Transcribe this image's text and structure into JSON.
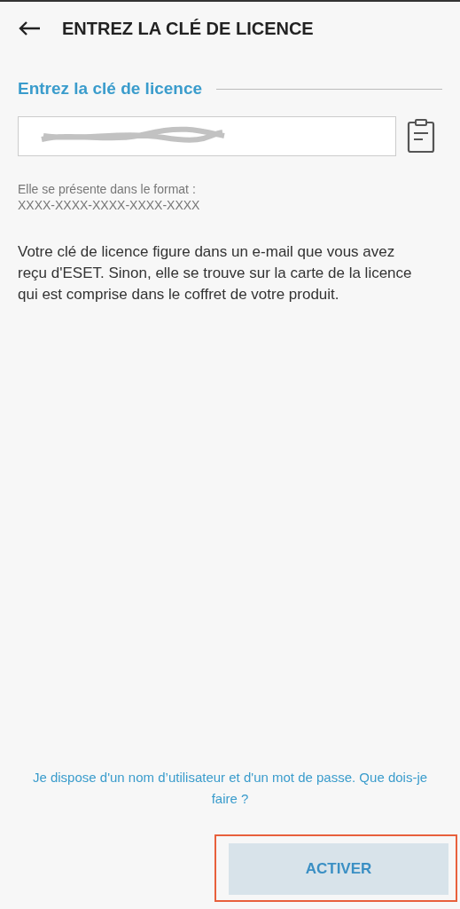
{
  "header": {
    "title": "ENTREZ LA CLÉ DE LICENCE"
  },
  "section": {
    "heading": "Entrez la clé de licence"
  },
  "license_field": {
    "redacted": true
  },
  "format_hint": {
    "label": "Elle se présente dans le format :",
    "pattern": "XXXX-XXXX-XXXX-XXXX-XXXX"
  },
  "description": "Votre clé de licence figure dans un e-mail que vous avez reçu d'ESET. Sinon, elle se trouve sur la carte de la licence qui est comprise dans le coffret de votre produit.",
  "help_link": "Je dispose d'un nom d’utilisateur et d'un mot de passe. Que dois-je faire ?",
  "activate_button": {
    "label": "ACTIVER",
    "highlighted": true
  }
}
